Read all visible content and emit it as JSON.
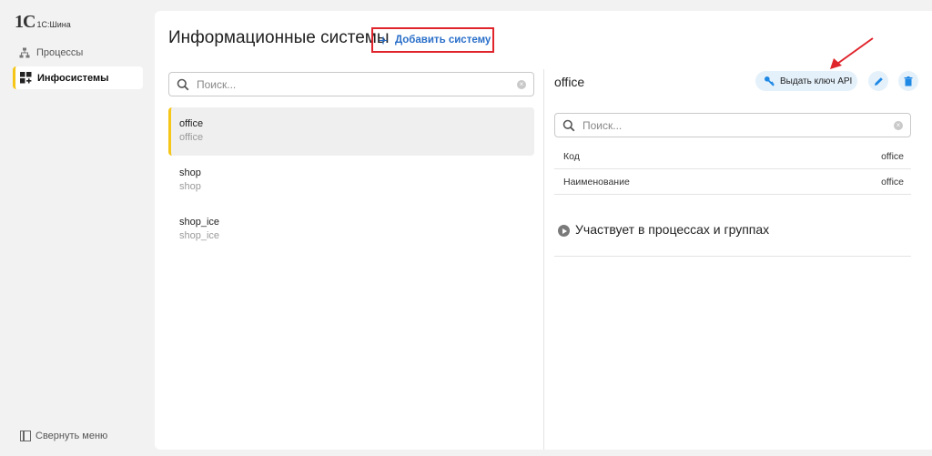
{
  "app": {
    "logo_mark": "1C",
    "logo_text": "1С:Шина"
  },
  "sidebar": {
    "items": [
      {
        "label": "Процессы",
        "icon": "hierarchy-icon"
      },
      {
        "label": "Инфосистемы",
        "icon": "grid-plus-icon",
        "active": true
      }
    ],
    "collapse_label": "Свернуть меню"
  },
  "header": {
    "title": "Информационные системы",
    "add_label": "Добавить систему"
  },
  "list": {
    "search_placeholder": "Поиск...",
    "items": [
      {
        "name": "office",
        "sub": "office",
        "selected": true
      },
      {
        "name": "shop",
        "sub": "shop"
      },
      {
        "name": "shop_ice",
        "sub": "shop_ice"
      }
    ]
  },
  "detail": {
    "title": "office",
    "api_button": "Выдать ключ API",
    "search_placeholder": "Поиск...",
    "fields": [
      {
        "key": "Код",
        "value": "office"
      },
      {
        "key": "Наименование",
        "value": "office"
      }
    ],
    "section_title": "Участвует в процессах и группах"
  },
  "colors": {
    "accent": "#f5c518",
    "link": "#2a6fc9",
    "highlight_border": "#e0242b",
    "pill_bg": "#e4f1fb",
    "icon_blue": "#1e88e5"
  }
}
